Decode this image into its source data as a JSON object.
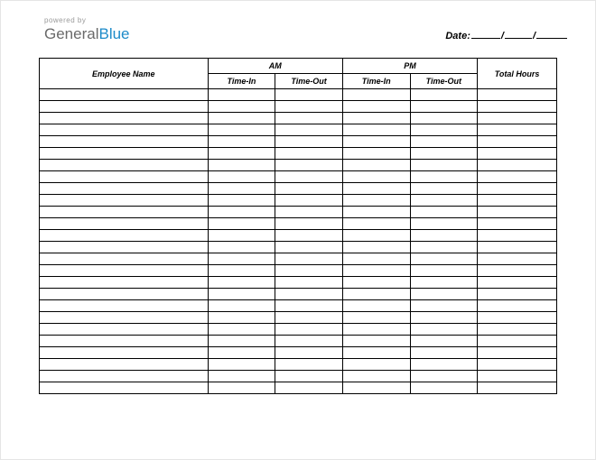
{
  "logo": {
    "powered_by": "powered by",
    "part1": "General",
    "part2": "Blue"
  },
  "date": {
    "label": "Date:",
    "sep": "/"
  },
  "headers": {
    "employee": "Employee Name",
    "am": "AM",
    "pm": "PM",
    "time_in": "Time-In",
    "time_out": "Time-Out",
    "total": "Total Hours"
  },
  "rows": [
    {
      "employee": "",
      "am_in": "",
      "am_out": "",
      "pm_in": "",
      "pm_out": "",
      "total": ""
    },
    {
      "employee": "",
      "am_in": "",
      "am_out": "",
      "pm_in": "",
      "pm_out": "",
      "total": ""
    },
    {
      "employee": "",
      "am_in": "",
      "am_out": "",
      "pm_in": "",
      "pm_out": "",
      "total": ""
    },
    {
      "employee": "",
      "am_in": "",
      "am_out": "",
      "pm_in": "",
      "pm_out": "",
      "total": ""
    },
    {
      "employee": "",
      "am_in": "",
      "am_out": "",
      "pm_in": "",
      "pm_out": "",
      "total": ""
    },
    {
      "employee": "",
      "am_in": "",
      "am_out": "",
      "pm_in": "",
      "pm_out": "",
      "total": ""
    },
    {
      "employee": "",
      "am_in": "",
      "am_out": "",
      "pm_in": "",
      "pm_out": "",
      "total": ""
    },
    {
      "employee": "",
      "am_in": "",
      "am_out": "",
      "pm_in": "",
      "pm_out": "",
      "total": ""
    },
    {
      "employee": "",
      "am_in": "",
      "am_out": "",
      "pm_in": "",
      "pm_out": "",
      "total": ""
    },
    {
      "employee": "",
      "am_in": "",
      "am_out": "",
      "pm_in": "",
      "pm_out": "",
      "total": ""
    },
    {
      "employee": "",
      "am_in": "",
      "am_out": "",
      "pm_in": "",
      "pm_out": "",
      "total": ""
    },
    {
      "employee": "",
      "am_in": "",
      "am_out": "",
      "pm_in": "",
      "pm_out": "",
      "total": ""
    },
    {
      "employee": "",
      "am_in": "",
      "am_out": "",
      "pm_in": "",
      "pm_out": "",
      "total": ""
    },
    {
      "employee": "",
      "am_in": "",
      "am_out": "",
      "pm_in": "",
      "pm_out": "",
      "total": ""
    },
    {
      "employee": "",
      "am_in": "",
      "am_out": "",
      "pm_in": "",
      "pm_out": "",
      "total": ""
    },
    {
      "employee": "",
      "am_in": "",
      "am_out": "",
      "pm_in": "",
      "pm_out": "",
      "total": ""
    },
    {
      "employee": "",
      "am_in": "",
      "am_out": "",
      "pm_in": "",
      "pm_out": "",
      "total": ""
    },
    {
      "employee": "",
      "am_in": "",
      "am_out": "",
      "pm_in": "",
      "pm_out": "",
      "total": ""
    },
    {
      "employee": "",
      "am_in": "",
      "am_out": "",
      "pm_in": "",
      "pm_out": "",
      "total": ""
    },
    {
      "employee": "",
      "am_in": "",
      "am_out": "",
      "pm_in": "",
      "pm_out": "",
      "total": ""
    },
    {
      "employee": "",
      "am_in": "",
      "am_out": "",
      "pm_in": "",
      "pm_out": "",
      "total": ""
    },
    {
      "employee": "",
      "am_in": "",
      "am_out": "",
      "pm_in": "",
      "pm_out": "",
      "total": ""
    },
    {
      "employee": "",
      "am_in": "",
      "am_out": "",
      "pm_in": "",
      "pm_out": "",
      "total": ""
    },
    {
      "employee": "",
      "am_in": "",
      "am_out": "",
      "pm_in": "",
      "pm_out": "",
      "total": ""
    },
    {
      "employee": "",
      "am_in": "",
      "am_out": "",
      "pm_in": "",
      "pm_out": "",
      "total": ""
    },
    {
      "employee": "",
      "am_in": "",
      "am_out": "",
      "pm_in": "",
      "pm_out": "",
      "total": ""
    }
  ]
}
